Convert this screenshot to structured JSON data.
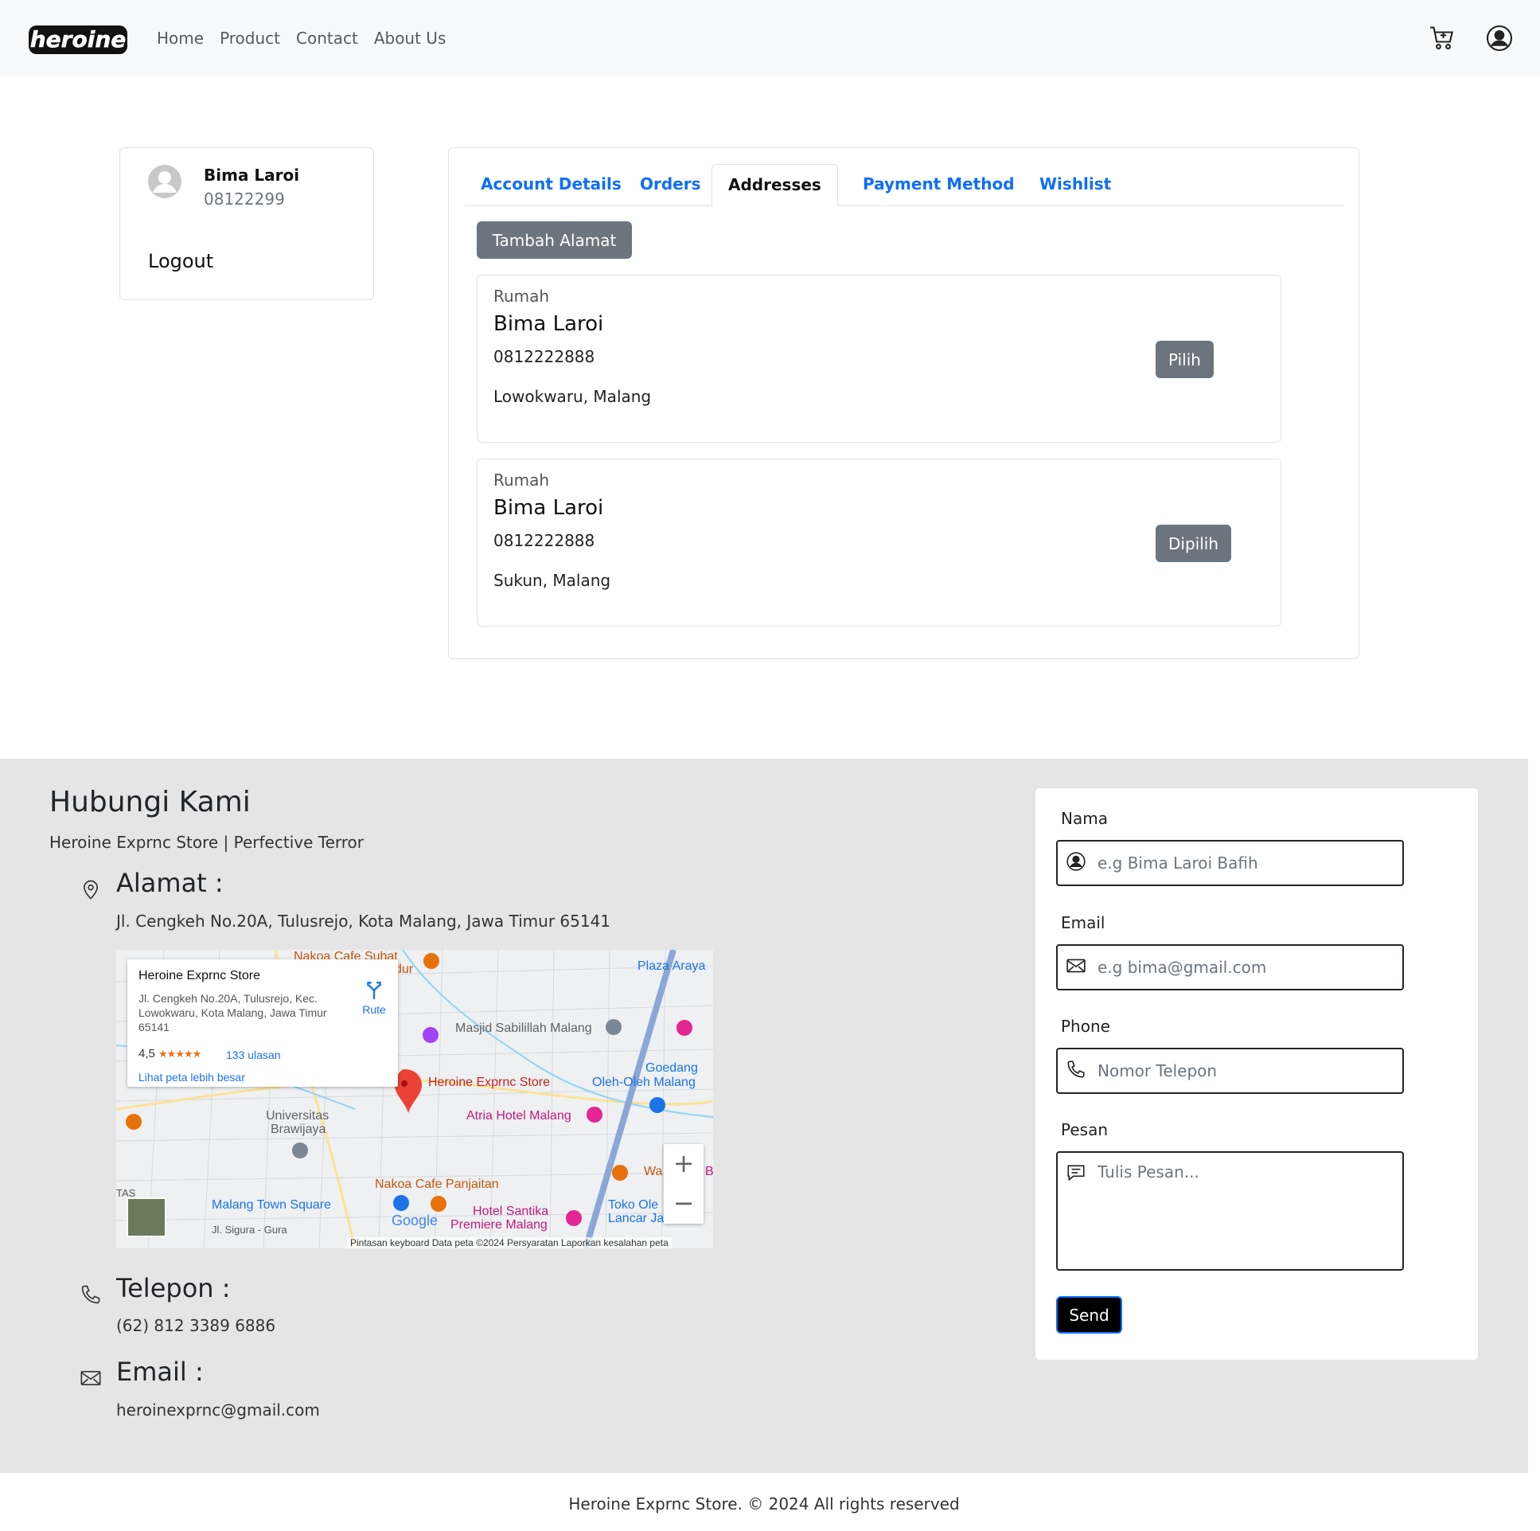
{
  "nav": {
    "logo_text": "heroine",
    "links": [
      "Home",
      "Product",
      "Contact",
      "About Us"
    ],
    "cart_icon": "cart-icon",
    "profile_icon": "user-circle-icon"
  },
  "profile": {
    "name": "Bima Laroi",
    "phone": "08122299",
    "logout": "Logout"
  },
  "tabs": [
    "Account Details",
    "Orders",
    "Addresses",
    "Payment Method",
    "Wishlist"
  ],
  "active_tab": "Addresses",
  "add_address_label": "Tambah Alamat",
  "addresses": [
    {
      "label": "Rumah",
      "name": "Bima Laroi",
      "phone": "0812222888",
      "area": "Lowokwaru, Malang",
      "button": "Pilih"
    },
    {
      "label": "Rumah",
      "name": "Bima Laroi",
      "phone": "0812222888",
      "area": "Sukun, Malang",
      "button": "Dipilih"
    }
  ],
  "contact": {
    "title": "Hubungi Kami",
    "subtitle": "Heroine Exprnc Store | Perfective Terror",
    "address_heading": "Alamat :",
    "address": "Jl. Cengkeh No.20A, Tulusrejo, Kota Malang, Jawa Timur 65141",
    "phone_heading": "Telepon :",
    "phone": "(62) 812 3389 6886",
    "email_heading": "Email :",
    "email": "heroinexprnc@gmail.com"
  },
  "map": {
    "popup_title": "Heroine Exprnc Store",
    "popup_address": "Jl. Cengkeh No.20A, Tulusrejo, Kec. Lowokwaru, Kota Malang, Jawa Timur 65141",
    "rating": "4,5",
    "stars": "★★★★★",
    "reviews": "133 ulasan",
    "bigger_map": "Lihat peta lebih besar",
    "route": "Rute",
    "pin_label": "Heroine Exprnc Store",
    "places": {
      "p1": "Nakoa Cafe Suhat",
      "p2": "Plaza Araya",
      "p3": "Masjid Sabilillah Malang",
      "p4": "Goedang",
      "p5": "Oleh-Oleh Malang",
      "p6": "Atria Hotel Malang",
      "p7": "Universitas",
      "p8": "Brawijaya",
      "p9": "Nakoa Cafe Panjaitan",
      "p10": "Malang Town Square",
      "p11": "Hotel Santika",
      "p12": "Premiere Malang",
      "p13": "Toko Ole",
      "p14": "Lancar Ja",
      "p15": "Jl. Sigura - Gura",
      "p16": "dur",
      "p17": "Wa",
      "p18": "B",
      "p19": "TAS"
    },
    "google": "Google",
    "footer": "Pintasan keyboard    Data peta ©2024    Persyaratan    Laporkan kesalahan peta",
    "zoom_in": "+",
    "zoom_out": "−"
  },
  "form": {
    "name_label": "Nama",
    "name_placeholder": "e.g Bima Laroi Bafih",
    "email_label": "Email",
    "email_placeholder": "e.g bima@gmail.com",
    "phone_label": "Phone",
    "phone_placeholder": "Nomor Telepon",
    "message_label": "Pesan",
    "message_placeholder": "Tulis Pesan...",
    "send": "Send"
  },
  "copyright": "Heroine Exprnc Store. © 2024 All rights reserved"
}
